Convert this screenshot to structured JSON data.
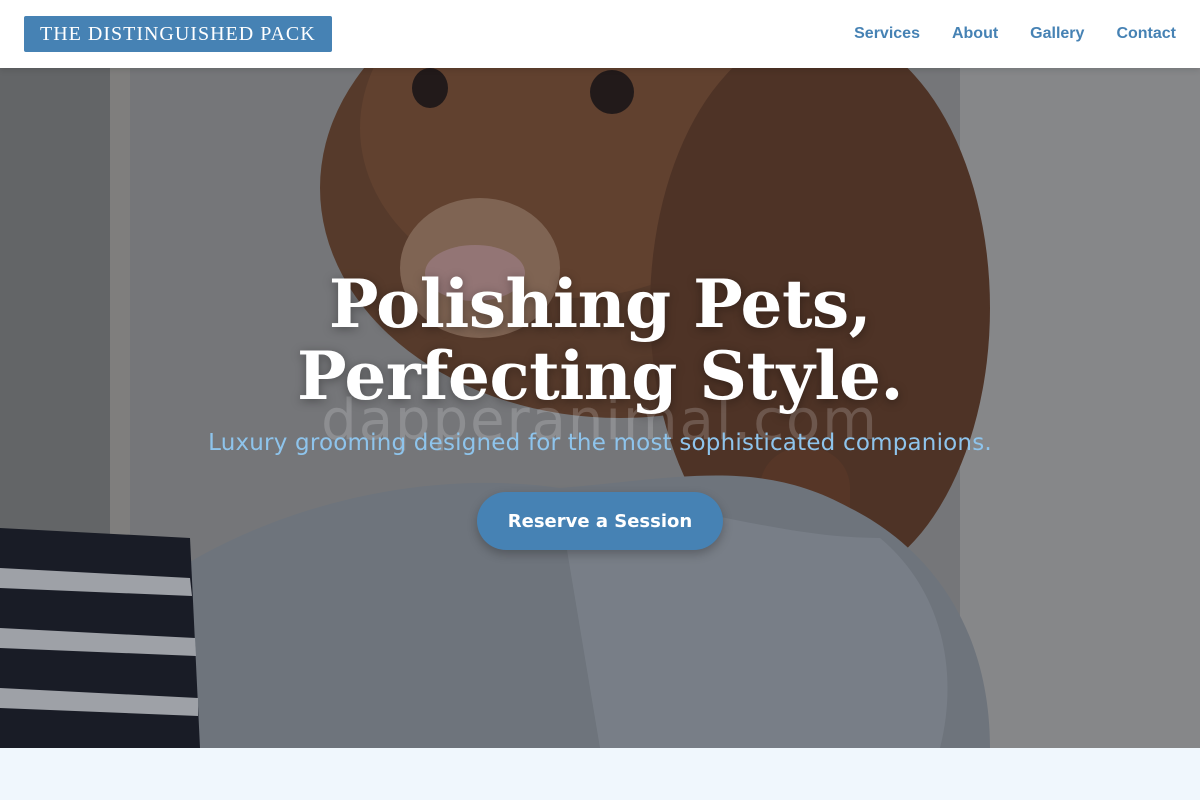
{
  "brand": {
    "name": "THE DISTINGUISHED PACK"
  },
  "nav": {
    "items": [
      {
        "label": "Services"
      },
      {
        "label": "About"
      },
      {
        "label": "Gallery"
      },
      {
        "label": "Contact"
      }
    ]
  },
  "hero": {
    "headline": "Polishing Pets, Perfecting Style.",
    "watermark": "dapperanimal.com",
    "subline": "Luxury grooming designed for the most sophisticated companions.",
    "cta_label": "Reserve a Session",
    "image_subject": "wet brown dog being dried with a grey towel"
  },
  "colors": {
    "accent": "#4682b4",
    "subline": "#8ec4ec",
    "page_background": "#f0f7fd",
    "header_background": "#ffffff"
  }
}
